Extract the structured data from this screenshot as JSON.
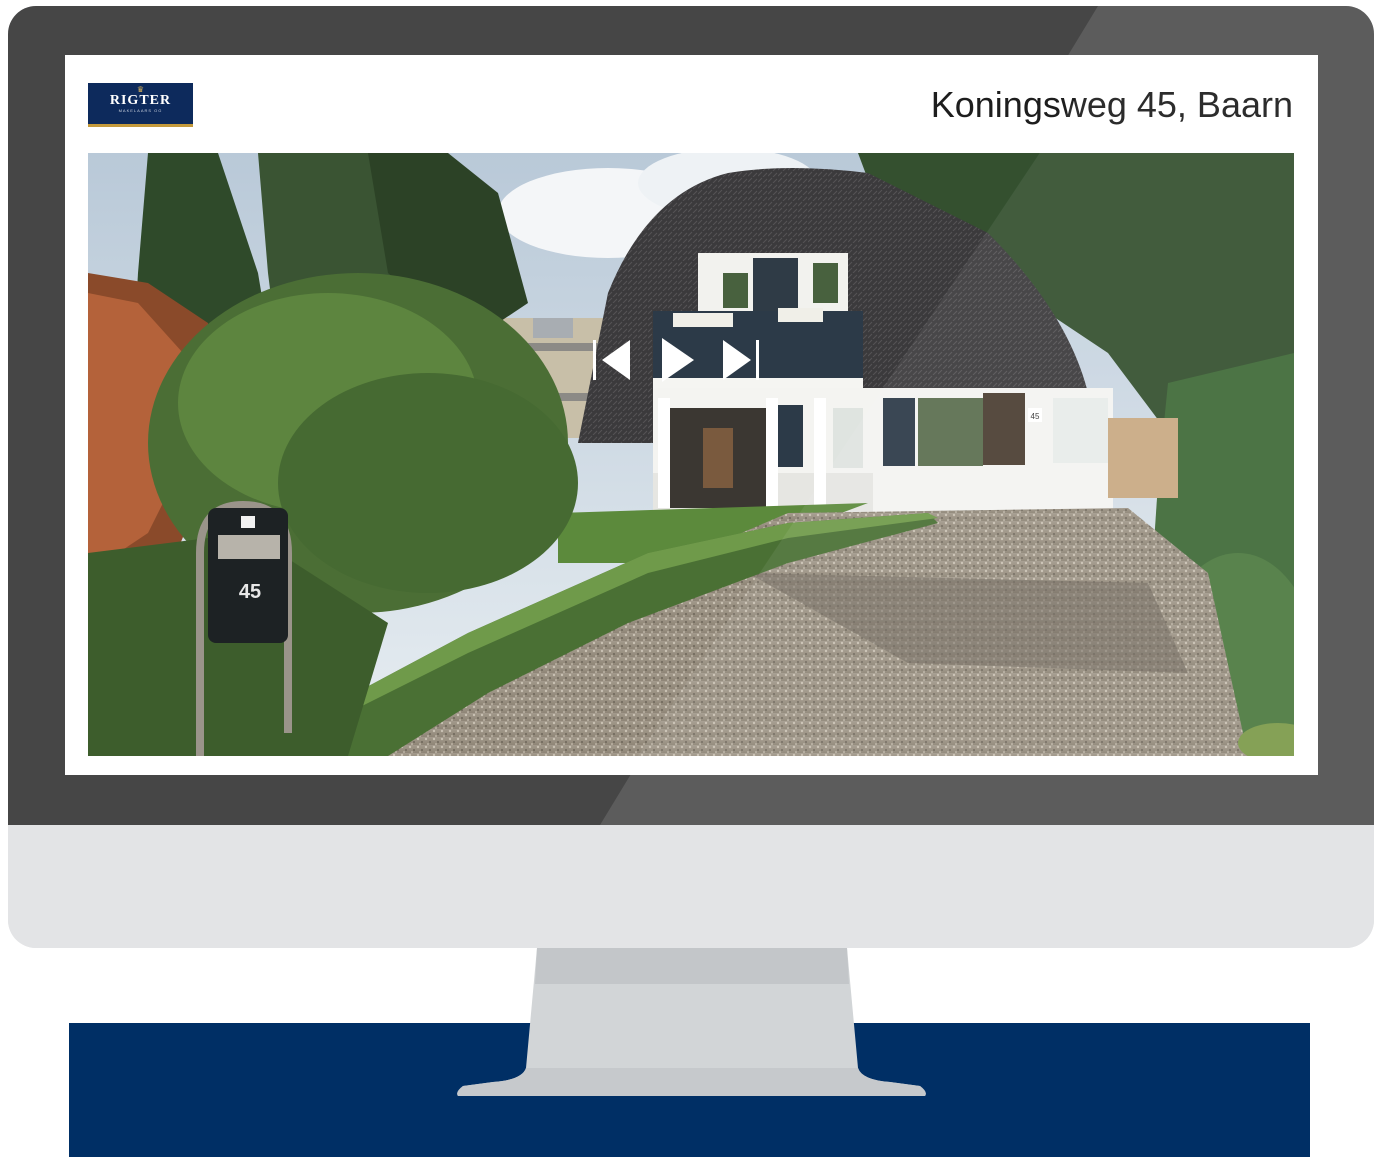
{
  "listing": {
    "address": "Koningsweg 45, Baarn",
    "mailbox_number": "45",
    "house_number_plate": "45"
  },
  "logo": {
    "brand": "RIGTER",
    "subtitle": "MAKELAARS OG",
    "crown_glyph": "♛"
  },
  "slideshow": {
    "controls": [
      "previous",
      "play",
      "next"
    ],
    "icons": [
      "skip-previous-icon",
      "play-icon",
      "skip-next-icon"
    ]
  },
  "colors": {
    "bezel": "#464646",
    "chin": "#e3e4e6",
    "navy": "#002f65",
    "stand": "#d0d3d5",
    "logo_bg": "#0d2a5c",
    "logo_accent": "#c49a3c"
  }
}
